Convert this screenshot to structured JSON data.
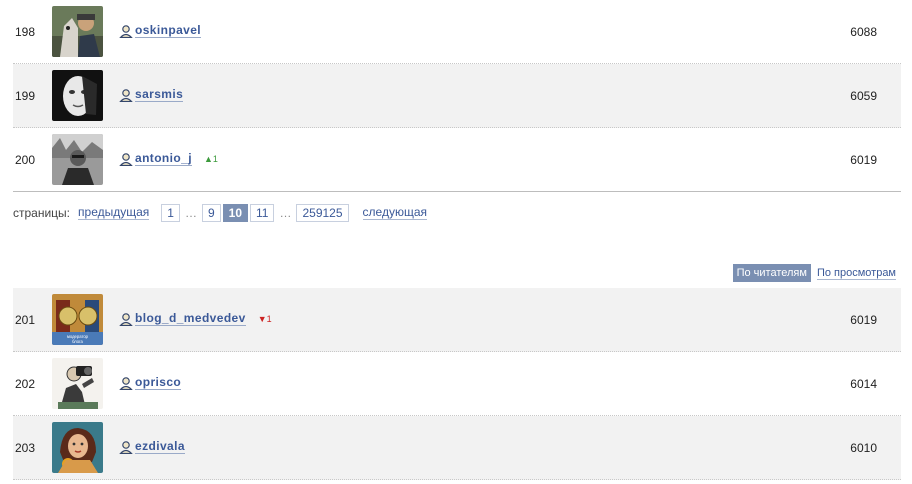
{
  "top_rows": [
    {
      "rank": "198",
      "username": "oskinpavel",
      "change": "",
      "count": "6088",
      "avatar": "person-with-dog-photo"
    },
    {
      "rank": "199",
      "username": "sarsmis",
      "change": "",
      "count": "6059",
      "avatar": "white-mask-photo"
    },
    {
      "rank": "200",
      "username": "antonio_j",
      "change": "▲1",
      "change_dir": "up",
      "count": "6019",
      "avatar": "man-outdoors-photo"
    }
  ],
  "pager": {
    "label": "страницы:",
    "prev": "предыдущая",
    "next": "следующая",
    "first": "1",
    "dots": "…",
    "pages": [
      "9",
      "10",
      "11"
    ],
    "current": "10",
    "last": "259125"
  },
  "sort": {
    "by_readers": "По читателям",
    "by_views": "По просмотрам"
  },
  "bottom_rows": [
    {
      "rank": "201",
      "username": "blog_d_medvedev",
      "change": "▼1",
      "change_dir": "down",
      "count": "6019",
      "avatar": "moderator-badge-image",
      "avatar_caption": "модератор блога"
    },
    {
      "rank": "202",
      "username": "oprisco",
      "change": "",
      "count": "6014",
      "avatar": "vintage-photographer-drawing"
    },
    {
      "rank": "203",
      "username": "ezdivala",
      "change": "",
      "count": "6010",
      "avatar": "vintage-woman-portrait"
    }
  ],
  "colors": {
    "link": "#3b5998",
    "accent": "#7a8fb2",
    "up": "#3c9a3c",
    "down": "#cc2222",
    "row_shade": "#f2f2f2"
  },
  "icons": {
    "user": "user-profile-icon",
    "up": "triangle-up-icon",
    "down": "triangle-down-icon"
  }
}
